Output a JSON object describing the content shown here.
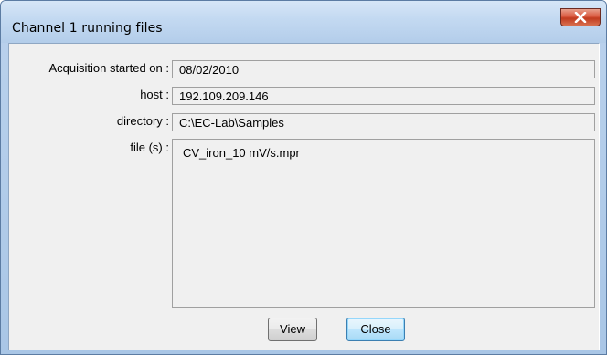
{
  "window": {
    "title": "Channel 1 running files"
  },
  "fields": {
    "acquisition_label": "Acquisition started on :",
    "acquisition_value": "08/02/2010",
    "host_label": "host :",
    "host_value": "192.109.209.146",
    "directory_label": "directory :",
    "directory_value": "C:\\EC-Lab\\Samples",
    "files_label": "file (s) :",
    "files": [
      "CV_iron_10 mV/s.mpr"
    ]
  },
  "buttons": {
    "view_label": "View",
    "close_label": "Close"
  },
  "icons": {
    "close": "close-icon"
  }
}
